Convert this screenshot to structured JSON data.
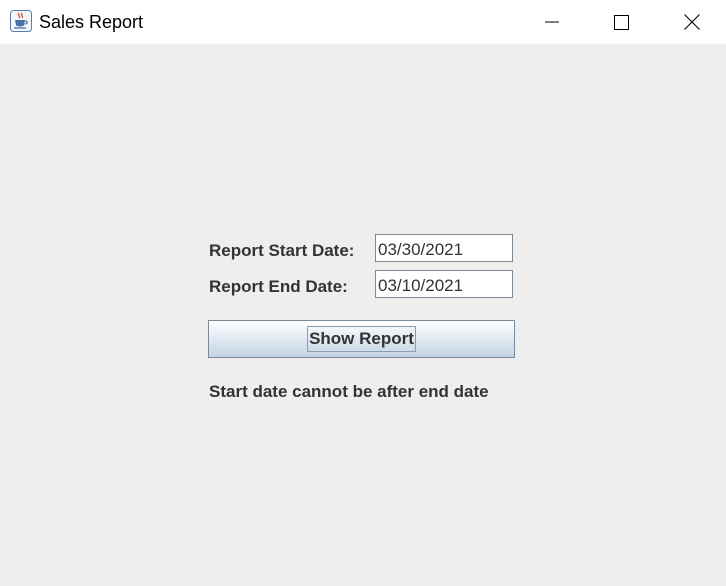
{
  "window": {
    "title": "Sales Report",
    "app_icon": "java-coffee-cup-icon",
    "controls": {
      "minimize_icon": "minimize-icon",
      "maximize_icon": "maximize-icon",
      "close_icon": "close-icon"
    }
  },
  "form": {
    "start_date_label": "Report Start Date:",
    "start_date_value": "03/30/2021",
    "end_date_label": "Report End Date:",
    "end_date_value": "03/10/2021",
    "show_report_label": "Show Report",
    "message": "Start date cannot be after end date"
  },
  "colors": {
    "background": "#eeeeee",
    "titlebar": "#ffffff",
    "text": "#333333"
  }
}
